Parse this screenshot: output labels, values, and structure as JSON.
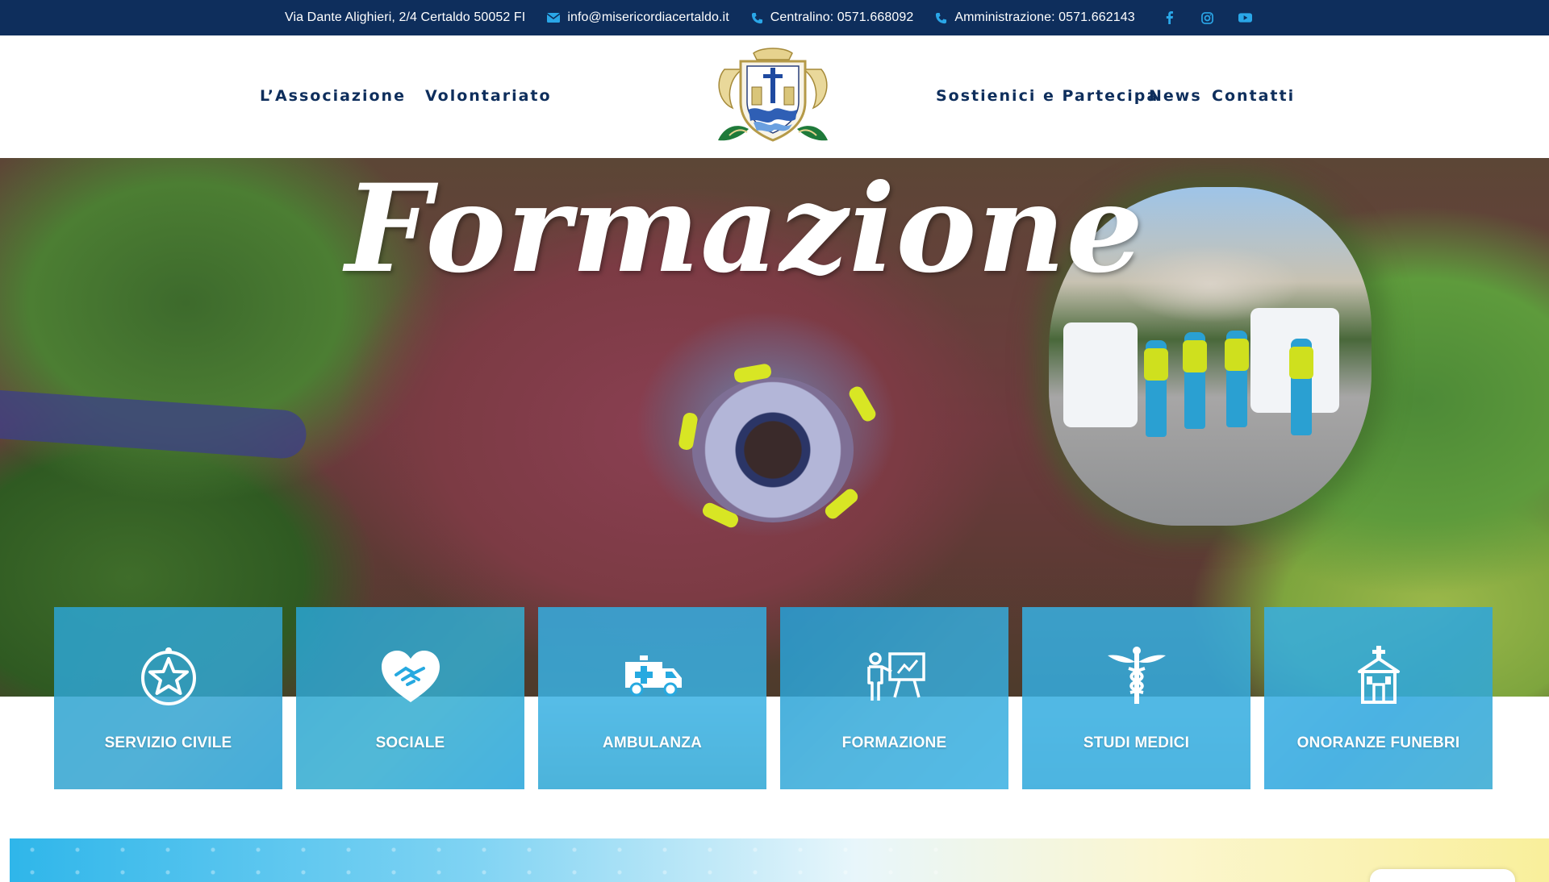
{
  "topbar": {
    "address": "Via Dante Alighieri, 2/4 Certaldo 50052 FI",
    "email": "info@misericordiacertaldo.it",
    "centralino": "Centralino: 0571.668092",
    "amministrazione": "Amministrazione: 0571.662143",
    "social": [
      "facebook-icon",
      "instagram-icon",
      "youtube-icon"
    ]
  },
  "nav": {
    "left": [
      "L’Associazione",
      "Volontariato"
    ],
    "right": [
      "Sostienici e Partecipa",
      "News",
      "Contatti"
    ]
  },
  "hero": {
    "title": "Formazione"
  },
  "services": [
    {
      "label": "SERVIZIO CIVILE",
      "icon": "star-badge-icon"
    },
    {
      "label": "SOCIALE",
      "icon": "heart-handshake-icon"
    },
    {
      "label": "AMBULANZA",
      "icon": "ambulance-icon"
    },
    {
      "label": "FORMAZIONE",
      "icon": "teacher-board-icon"
    },
    {
      "label": "STUDI MEDICI",
      "icon": "caduceus-icon"
    },
    {
      "label": "ONORANZE FUNEBRI",
      "icon": "chapel-icon"
    }
  ],
  "colors": {
    "topbar_bg": "#0e2e5c",
    "nav_text": "#0e2e5c",
    "card_overlay": "#26a9e0",
    "accent_icon": "#2aa7e8"
  }
}
